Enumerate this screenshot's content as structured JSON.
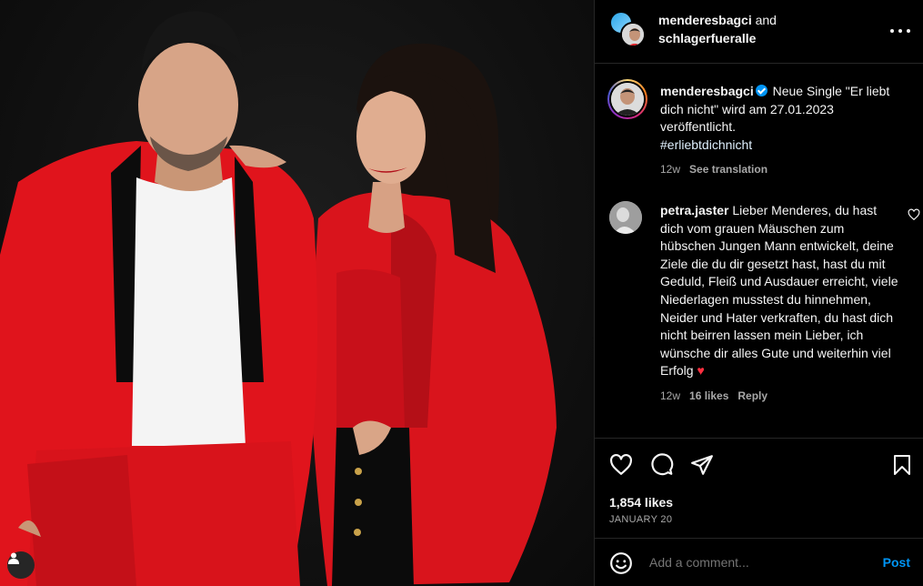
{
  "header": {
    "user1": "menderesbagci",
    "and_text": " and",
    "user2": "schlagerfueralle",
    "more_icon": "more-horizontal-icon"
  },
  "caption": {
    "user": "menderesbagci",
    "text": " Neue Single \"Er liebt dich nicht\" wird am 27.01.2023 veröffentlicht.",
    "hashtag": "#erliebtdichnicht",
    "time": "12w",
    "see_translation": "See translation"
  },
  "comment": {
    "user": "petra.jaster",
    "text": " Lieber Menderes, du hast dich vom grauen Mäuschen zum hübschen Jungen Mann entwickelt, deine Ziele die du dir gesetzt hast, hast du mit Geduld, Fleiß und Ausdauer erreicht, viele Niederlagen musstest du hinnehmen, Neider und Hater verkraften, du hast dich nicht beirren lassen mein Lieber, ich wünsche dir alles Gute und weiterhin viel Erfolg",
    "emoji": "♥",
    "time": "12w",
    "likes": "16 likes",
    "reply": "Reply"
  },
  "actions": {
    "likes": "1,854 likes",
    "date": "JANUARY 20",
    "icons": [
      "heart-icon",
      "comment-icon",
      "share-icon",
      "bookmark-icon"
    ]
  },
  "add_comment": {
    "placeholder": "Add a comment...",
    "post_label": "Post"
  },
  "colors": {
    "accent": "#0095f6",
    "suit_red": "#e0141c",
    "background": "#000000"
  }
}
